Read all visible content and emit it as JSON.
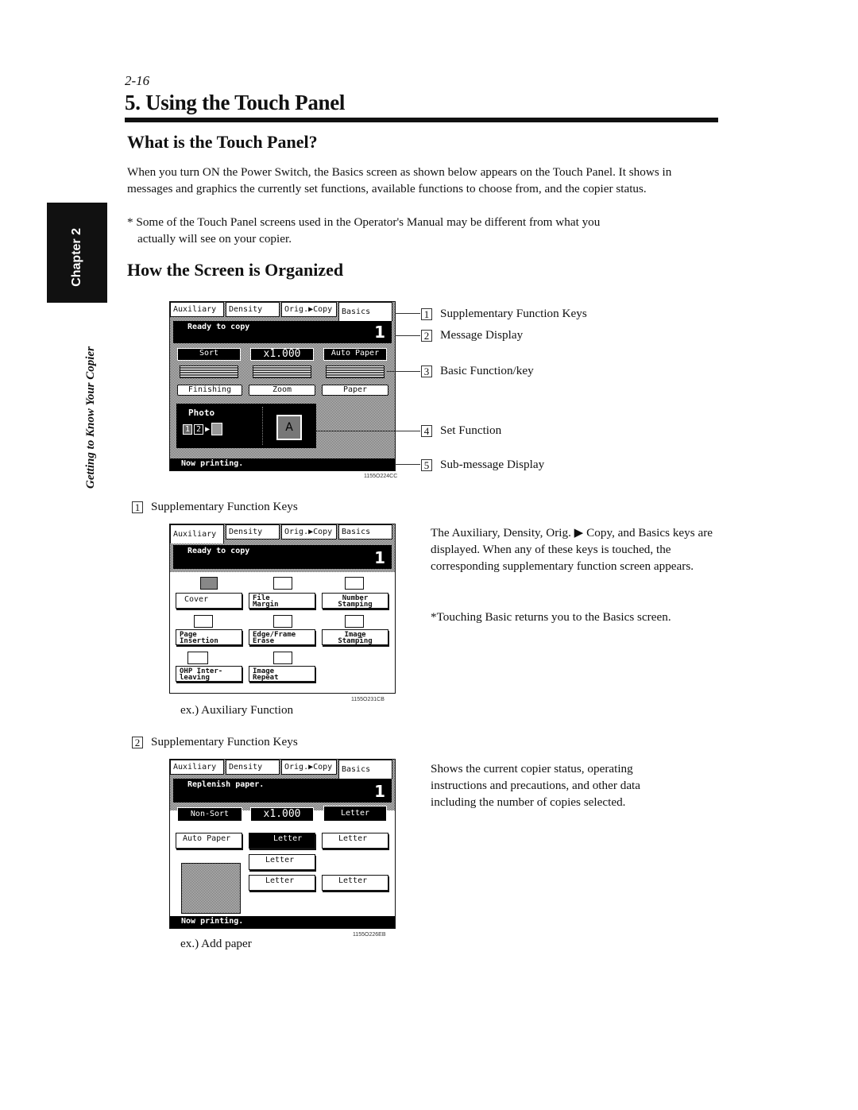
{
  "page": {
    "number": "2-16",
    "title": "5. Using the Touch Panel",
    "chapter_tab": "Chapter 2",
    "side_caption": "Getting to Know Your Copier"
  },
  "section1": {
    "heading": "What is the Touch Panel?",
    "paragraph": "When you turn ON the Power Switch, the Basics screen as shown below appears on the Touch Panel. It shows in messages and graphics the currently set functions, available functions to choose from, and the copier status.",
    "note_line1": "* Some of the Touch Panel screens used in the Operator's Manual may be different from what you",
    "note_line2": "actually will see on your copier."
  },
  "section2": {
    "heading": "How the Screen is Organized",
    "callouts": [
      {
        "num": "1",
        "label": "Supplementary Function Keys"
      },
      {
        "num": "2",
        "label": "Message Display"
      },
      {
        "num": "3",
        "label": "Basic Function/key"
      },
      {
        "num": "4",
        "label": "Set Function"
      },
      {
        "num": "5",
        "label": "Sub-message Display"
      }
    ]
  },
  "screen_basics": {
    "tabs": [
      "Auxiliary",
      "Density",
      "Orig.▶Copy",
      "Basics"
    ],
    "message": "Ready to copy",
    "count": "1",
    "keys": [
      {
        "value": "Sort",
        "label": "Finishing"
      },
      {
        "value": "x1.000",
        "label": "Zoom"
      },
      {
        "value": "Auto Paper",
        "label": "Paper"
      }
    ],
    "set_function": {
      "mode": "Photo",
      "page1": "1",
      "page2": "2",
      "letter": "A"
    },
    "sub_message": "Now printing.",
    "figure_id": "1155O224CC"
  },
  "item1": {
    "num": "1",
    "label": "Supplementary Function Keys",
    "description": "The Auxiliary, Density, Orig. ▶ Copy, and Basics keys are displayed. When any of these keys is touched, the corresponding supplementary function screen appears.",
    "note": "*Touching Basic returns you to the Basics screen.",
    "caption": "ex.) Auxiliary Function"
  },
  "screen_auxiliary": {
    "tabs": [
      "Auxiliary",
      "Density",
      "Orig.▶Copy",
      "Basics"
    ],
    "message": "Ready to copy",
    "count": "1",
    "buttons": [
      {
        "line1": "Cover",
        "line2": ""
      },
      {
        "line1": "File",
        "line2": "Margin"
      },
      {
        "line1": "Number",
        "line2": "Stamping"
      },
      {
        "line1": "Page",
        "line2": "Insertion"
      },
      {
        "line1": "Edge/Frame",
        "line2": "Erase"
      },
      {
        "line1": "Image",
        "line2": "Stamping"
      },
      {
        "line1": "OHP Inter-",
        "line2": "leaving"
      },
      {
        "line1": "Image",
        "line2": "Repeat"
      }
    ],
    "figure_id": "1155O231CB"
  },
  "item2": {
    "num": "2",
    "label": "Supplementary Function Keys",
    "description": "Shows the current copier status, operating instructions and precautions, and other data including the number of copies selected.",
    "caption": "ex.) Add paper"
  },
  "screen_paper": {
    "tabs": [
      "Auxiliary",
      "Density",
      "Orig.▶Copy",
      "Basics"
    ],
    "message": "Replenish paper.",
    "count": "1",
    "keys": [
      "Non-Sort",
      "x1.000",
      "Letter"
    ],
    "buttons": [
      "Auto Paper",
      "Letter",
      "Letter",
      "Letter",
      "Letter",
      "Letter"
    ],
    "sub_message": "Now printing.",
    "figure_id": "1155O226EB"
  }
}
